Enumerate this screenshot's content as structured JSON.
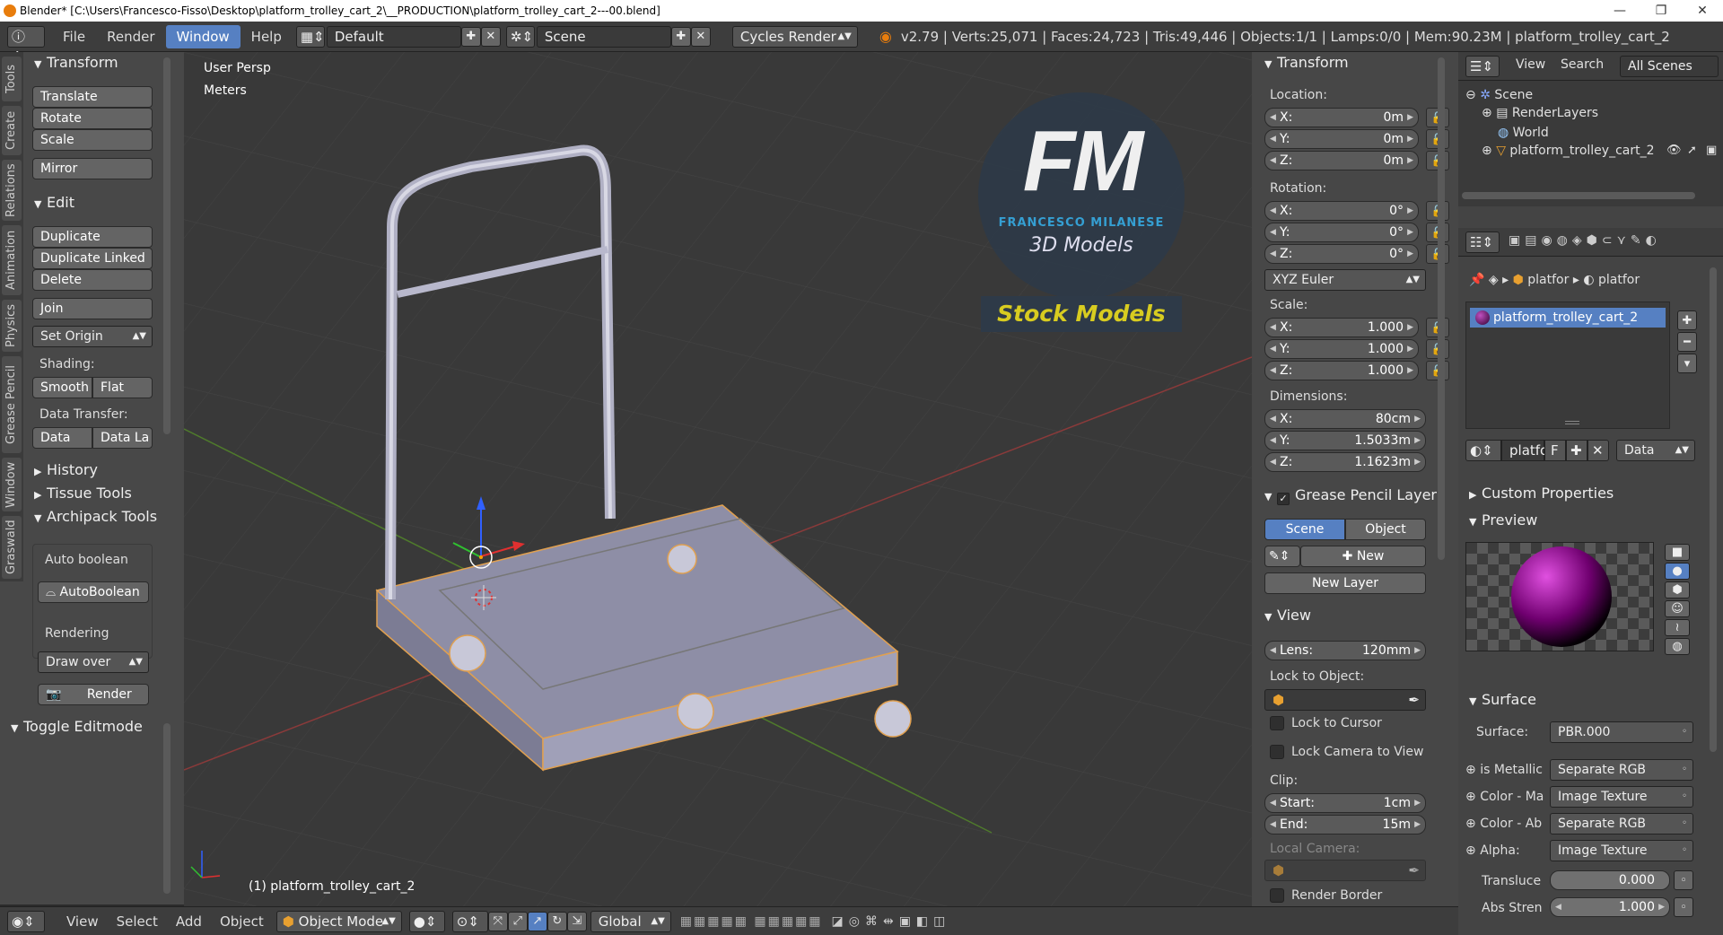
{
  "titlebar": {
    "title": "Blender* [C:\\Users\\Francesco-Fisso\\Desktop\\platform_trolley_cart_2\\__PRODUCTION\\platform_trolley_cart_2---00.blend]"
  },
  "menubar": {
    "items": [
      "File",
      "Render",
      "Window",
      "Help"
    ],
    "layout": "Default",
    "scene": "Scene",
    "engine": "Cycles Render",
    "stats": "v2.79 | Verts:25,071 | Faces:24,723 | Tris:49,446 | Objects:1/1 | Lamps:0/0 | Mem:90.23M | platform_trolley_cart_2"
  },
  "tool_tabs": [
    "Tools",
    "Create",
    "Relations",
    "Animation",
    "Physics",
    "Grease Pencil",
    "Window",
    "Graswald"
  ],
  "tools": {
    "transform": {
      "title": "Transform",
      "buttons": [
        "Translate",
        "Rotate",
        "Scale",
        "Mirror"
      ]
    },
    "edit": {
      "title": "Edit",
      "buttons": [
        "Duplicate",
        "Duplicate Linked",
        "Delete",
        "Join"
      ],
      "set_origin": "Set Origin",
      "shading_label": "Shading:",
      "smooth": "Smooth",
      "flat": "Flat",
      "data_transfer_label": "Data Transfer:",
      "data": "Data",
      "data_la": "Data La"
    },
    "history": "History",
    "tissue": "Tissue Tools",
    "archipack": "Archipack Tools",
    "auto_boolean": "Auto boolean",
    "autoboolean_btn": "AutoBoolean",
    "rendering": "Rendering",
    "draw_over": "Draw over",
    "render": "Render",
    "toggle_editmode": "Toggle Editmode"
  },
  "viewport": {
    "view_name": "User Persp",
    "units": "Meters",
    "object_label": "(1) platform_trolley_cart_2",
    "logo": {
      "initials": "FM",
      "name": "FRANCESCO MILANESE",
      "sub": "3D Models",
      "badge": "Stock Models"
    }
  },
  "properties": {
    "transform_title": "Transform",
    "location_label": "Location:",
    "location": [
      {
        "k": "X:",
        "v": "0m"
      },
      {
        "k": "Y:",
        "v": "0m"
      },
      {
        "k": "Z:",
        "v": "0m"
      }
    ],
    "rotation_label": "Rotation:",
    "rotation": [
      {
        "k": "X:",
        "v": "0°"
      },
      {
        "k": "Y:",
        "v": "0°"
      },
      {
        "k": "Z:",
        "v": "0°"
      }
    ],
    "rotation_mode": "XYZ Euler",
    "scale_label": "Scale:",
    "scale": [
      {
        "k": "X:",
        "v": "1.000"
      },
      {
        "k": "Y:",
        "v": "1.000"
      },
      {
        "k": "Z:",
        "v": "1.000"
      }
    ],
    "dimensions_label": "Dimensions:",
    "dimensions": [
      {
        "k": "X:",
        "v": "80cm"
      },
      {
        "k": "Y:",
        "v": "1.5033m"
      },
      {
        "k": "Z:",
        "v": "1.1623m"
      }
    ],
    "grease_title": "Grease Pencil Layer",
    "scene_tab": "Scene",
    "object_tab": "Object",
    "new": "New",
    "new_layer": "New Layer",
    "view_title": "View",
    "lens_k": "Lens:",
    "lens_v": "120mm",
    "lock_to_object": "Lock to Object:",
    "lock_to_cursor": "Lock to Cursor",
    "lock_camera": "Lock Camera to View",
    "clip_label": "Clip:",
    "clip_start_k": "Start:",
    "clip_start_v": "1cm",
    "clip_end_k": "End:",
    "clip_end_v": "15m",
    "local_camera": "Local Camera:",
    "render_border": "Render Border"
  },
  "outliner": {
    "view": "View",
    "search": "Search",
    "all_scenes": "All Scenes",
    "tree": [
      "Scene",
      "RenderLayers",
      "World",
      "platform_trolley_cart_2"
    ]
  },
  "material": {
    "breadcrumb": [
      "platfor",
      "platfor"
    ],
    "slot": "platform_trolley_cart_2",
    "mat_name": "platfo",
    "f": "F",
    "data": "Data",
    "custom_properties": "Custom Properties",
    "preview": "Preview",
    "surface_title": "Surface",
    "surface_label": "Surface:",
    "surface_value": "PBR.000",
    "rows": [
      {
        "k": "is Metallic",
        "v": "Separate RGB"
      },
      {
        "k": "Color - Ma",
        "v": "Image Texture"
      },
      {
        "k": "Color - Ab",
        "v": "Separate RGB"
      },
      {
        "k": "Alpha:",
        "v": "Image Texture"
      }
    ],
    "transluce_k": "Transluce",
    "transluce_v": "0.000",
    "abs_k": "Abs Stren",
    "abs_v": "1.000"
  },
  "bottombar": {
    "items": [
      "View",
      "Select",
      "Add",
      "Object"
    ],
    "mode": "Object Mode",
    "orientation": "Global"
  }
}
